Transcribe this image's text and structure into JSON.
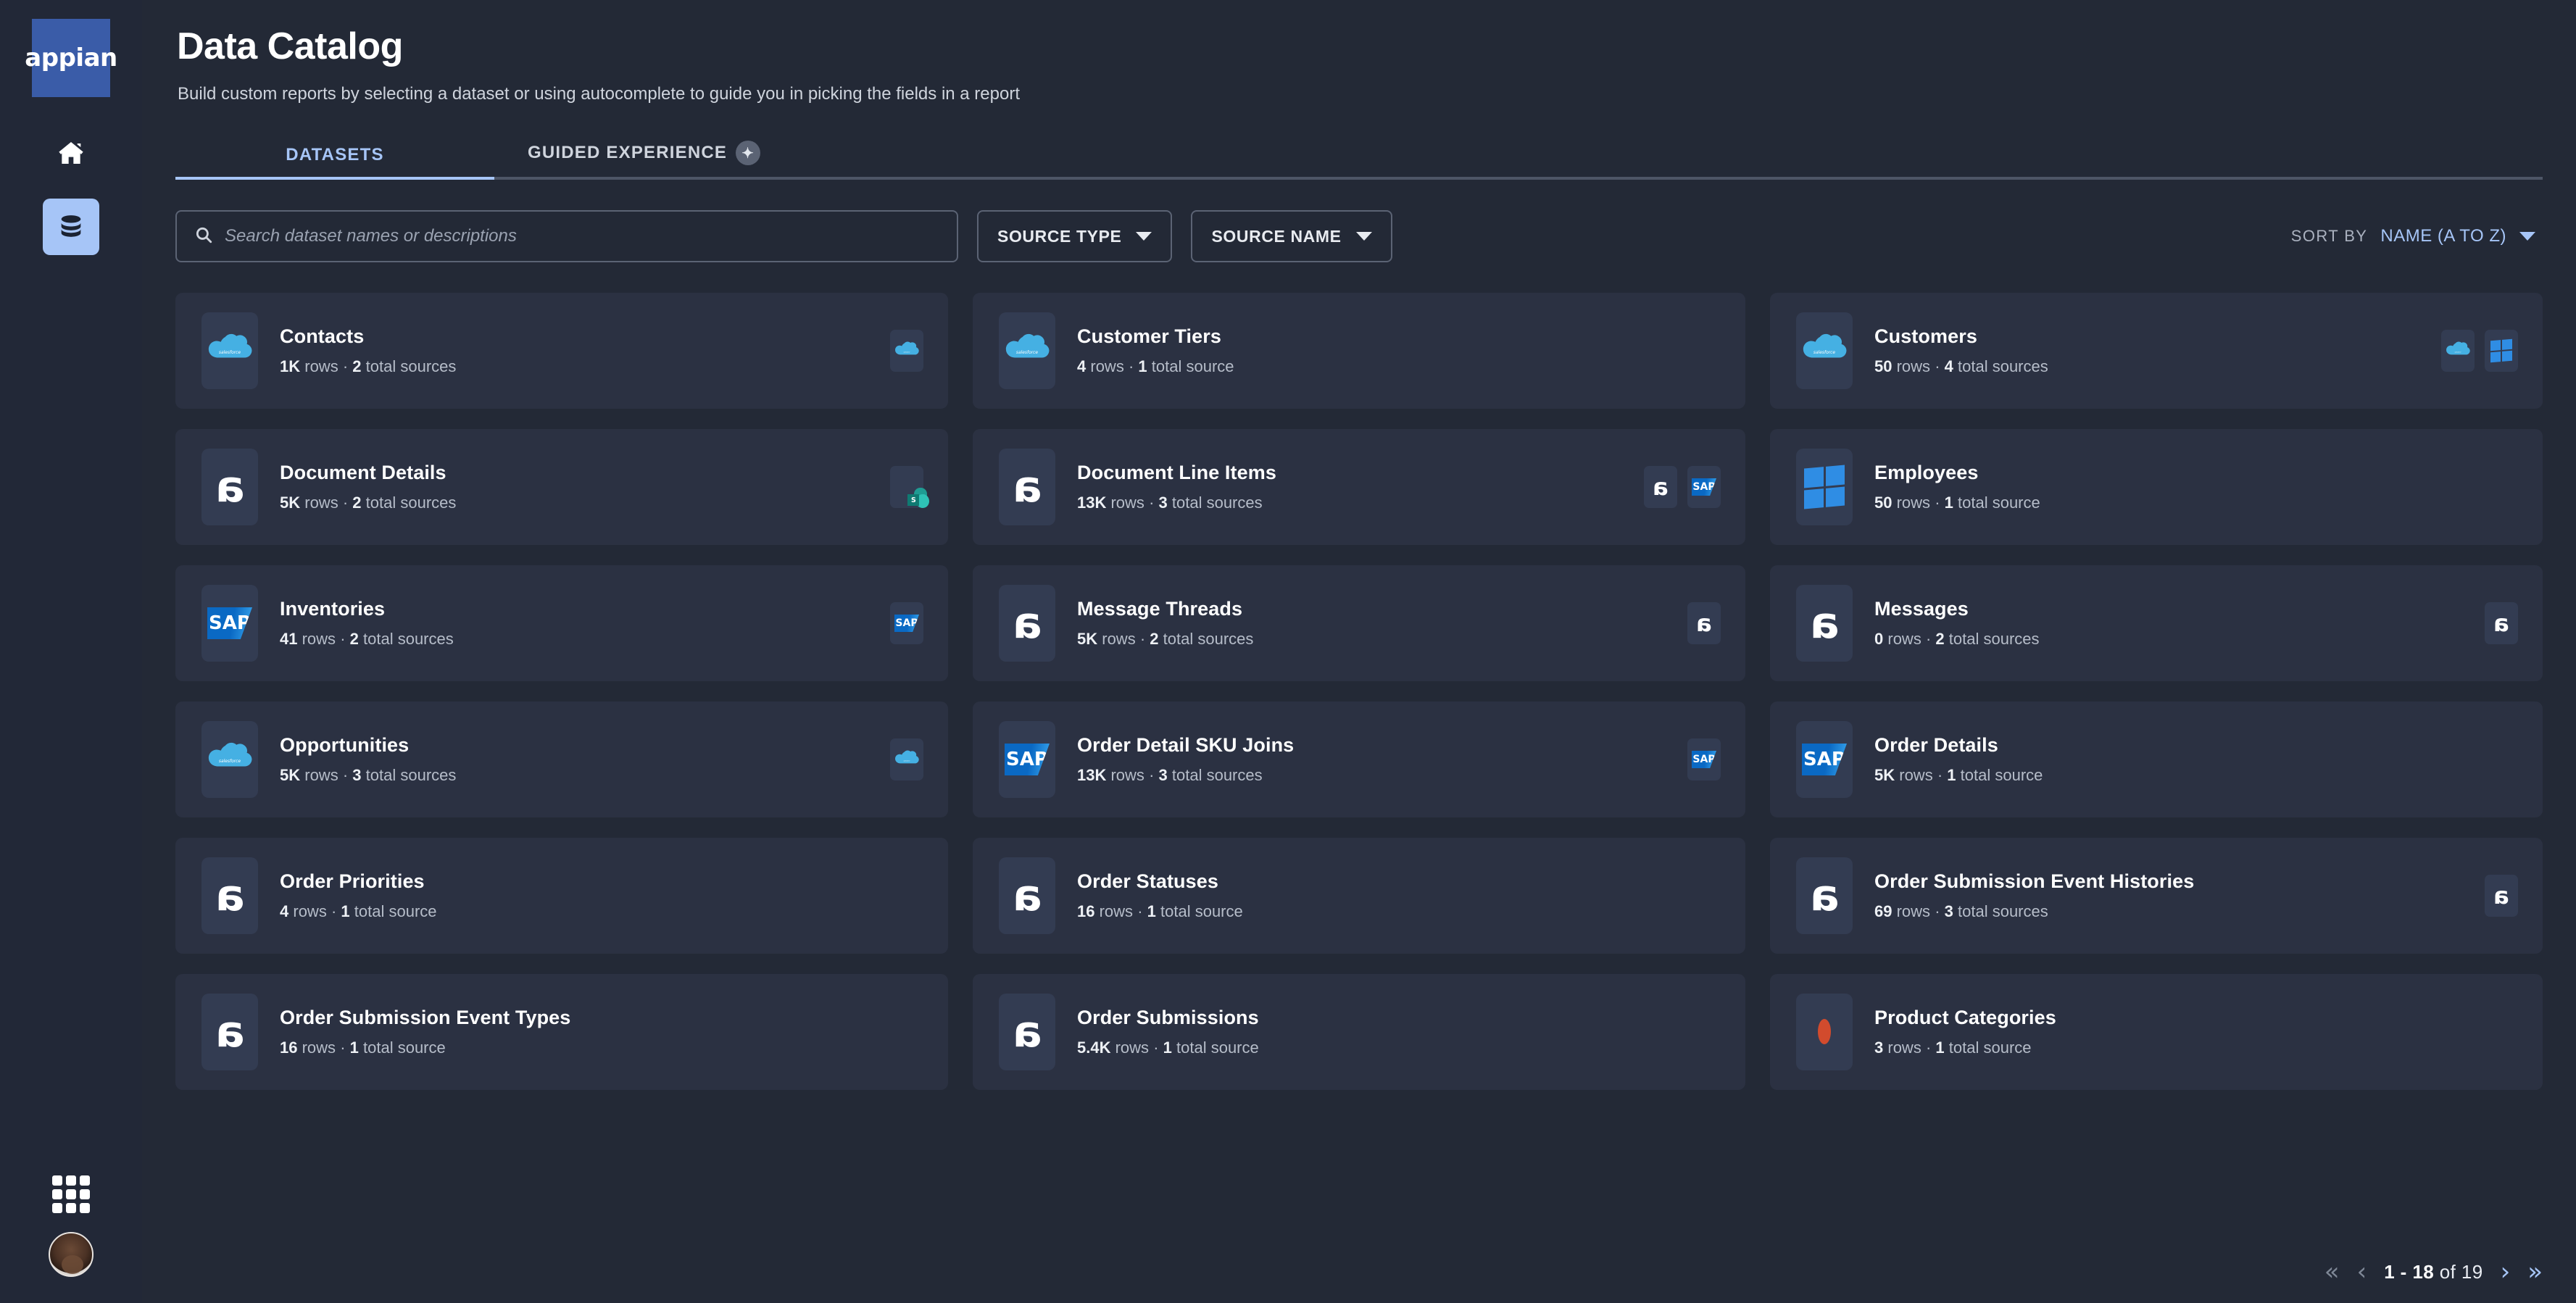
{
  "sidebar": {
    "logo_text": "appian",
    "items": [
      {
        "name": "home",
        "icon": "home-icon",
        "active": false
      },
      {
        "name": "data",
        "icon": "database-icon",
        "active": true
      }
    ],
    "bottom": [
      {
        "name": "apps",
        "icon": "grid-apps-icon"
      },
      {
        "name": "profile",
        "icon": "user-avatar"
      }
    ]
  },
  "header": {
    "title": "Data Catalog",
    "subtitle": "Build custom reports by selecting a dataset or using autocomplete to guide you in picking the fields in a report"
  },
  "tabs": [
    {
      "label": "DATASETS",
      "active": true
    },
    {
      "label": "GUIDED EXPERIENCE",
      "active": false,
      "icon": "sparkle-icon"
    }
  ],
  "toolbar": {
    "search_placeholder": "Search dataset names or descriptions",
    "search_value": "",
    "search_icon": "search-icon",
    "filters": [
      {
        "label": "SOURCE TYPE"
      },
      {
        "label": "SOURCE NAME"
      }
    ],
    "sort_label": "SORT BY",
    "sort_value": "NAME (A TO Z)"
  },
  "datasets": [
    {
      "title": "Contacts",
      "rows": "1K",
      "rows_unit": "rows",
      "sources": "2",
      "sources_unit": "total sources",
      "icon": "salesforce",
      "badges": [
        "salesforce"
      ]
    },
    {
      "title": "Customer Tiers",
      "rows": "4",
      "rows_unit": "rows",
      "sources": "1",
      "sources_unit": "total source",
      "icon": "salesforce",
      "badges": []
    },
    {
      "title": "Customers",
      "rows": "50",
      "rows_unit": "rows",
      "sources": "4",
      "sources_unit": "total sources",
      "icon": "salesforce",
      "badges": [
        "salesforce",
        "microsoft"
      ]
    },
    {
      "title": "Document Details",
      "rows": "5K",
      "rows_unit": "rows",
      "sources": "2",
      "sources_unit": "total sources",
      "icon": "appian",
      "badges": [
        "sharepoint"
      ]
    },
    {
      "title": "Document Line Items",
      "rows": "13K",
      "rows_unit": "rows",
      "sources": "3",
      "sources_unit": "total sources",
      "icon": "appian",
      "badges": [
        "appian",
        "sap"
      ]
    },
    {
      "title": "Employees",
      "rows": "50",
      "rows_unit": "rows",
      "sources": "1",
      "sources_unit": "total source",
      "icon": "microsoft",
      "badges": []
    },
    {
      "title": "Inventories",
      "rows": "41",
      "rows_unit": "rows",
      "sources": "2",
      "sources_unit": "total sources",
      "icon": "sap",
      "badges": [
        "sap"
      ]
    },
    {
      "title": "Message Threads",
      "rows": "5K",
      "rows_unit": "rows",
      "sources": "2",
      "sources_unit": "total sources",
      "icon": "appian",
      "badges": [
        "appian"
      ]
    },
    {
      "title": "Messages",
      "rows": "0",
      "rows_unit": "rows",
      "sources": "2",
      "sources_unit": "total sources",
      "icon": "appian",
      "badges": [
        "appian"
      ]
    },
    {
      "title": "Opportunities",
      "rows": "5K",
      "rows_unit": "rows",
      "sources": "3",
      "sources_unit": "total sources",
      "icon": "salesforce",
      "badges": [
        "salesforce"
      ]
    },
    {
      "title": "Order Detail SKU Joins",
      "rows": "13K",
      "rows_unit": "rows",
      "sources": "3",
      "sources_unit": "total sources",
      "icon": "sap",
      "badges": [
        "sap"
      ]
    },
    {
      "title": "Order Details",
      "rows": "5K",
      "rows_unit": "rows",
      "sources": "1",
      "sources_unit": "total source",
      "icon": "sap",
      "badges": []
    },
    {
      "title": "Order Priorities",
      "rows": "4",
      "rows_unit": "rows",
      "sources": "1",
      "sources_unit": "total source",
      "icon": "appian",
      "badges": []
    },
    {
      "title": "Order Statuses",
      "rows": "16",
      "rows_unit": "rows",
      "sources": "1",
      "sources_unit": "total source",
      "icon": "appian",
      "badges": []
    },
    {
      "title": "Order Submission Event Histories",
      "rows": "69",
      "rows_unit": "rows",
      "sources": "3",
      "sources_unit": "total sources",
      "icon": "appian",
      "badges": [
        "appian"
      ]
    },
    {
      "title": "Order Submission Event Types",
      "rows": "16",
      "rows_unit": "rows",
      "sources": "1",
      "sources_unit": "total source",
      "icon": "appian",
      "badges": []
    },
    {
      "title": "Order Submissions",
      "rows": "5.4K",
      "rows_unit": "rows",
      "sources": "1",
      "sources_unit": "total source",
      "icon": "appian",
      "badges": []
    },
    {
      "title": "Product Categories",
      "rows": "3",
      "rows_unit": "rows",
      "sources": "1",
      "sources_unit": "total source",
      "icon": "oracle",
      "badges": []
    }
  ],
  "pagination": {
    "first_icon": "«",
    "prev_icon": "‹",
    "range_start": "1",
    "range_end": "18",
    "of_text": "of",
    "total": "19",
    "next_icon": "›",
    "last_icon": "»"
  },
  "colors": {
    "background": "#232936",
    "card": "#2b3142",
    "accent": "#a6c5f7",
    "logo_blue": "#3a5ca8"
  }
}
